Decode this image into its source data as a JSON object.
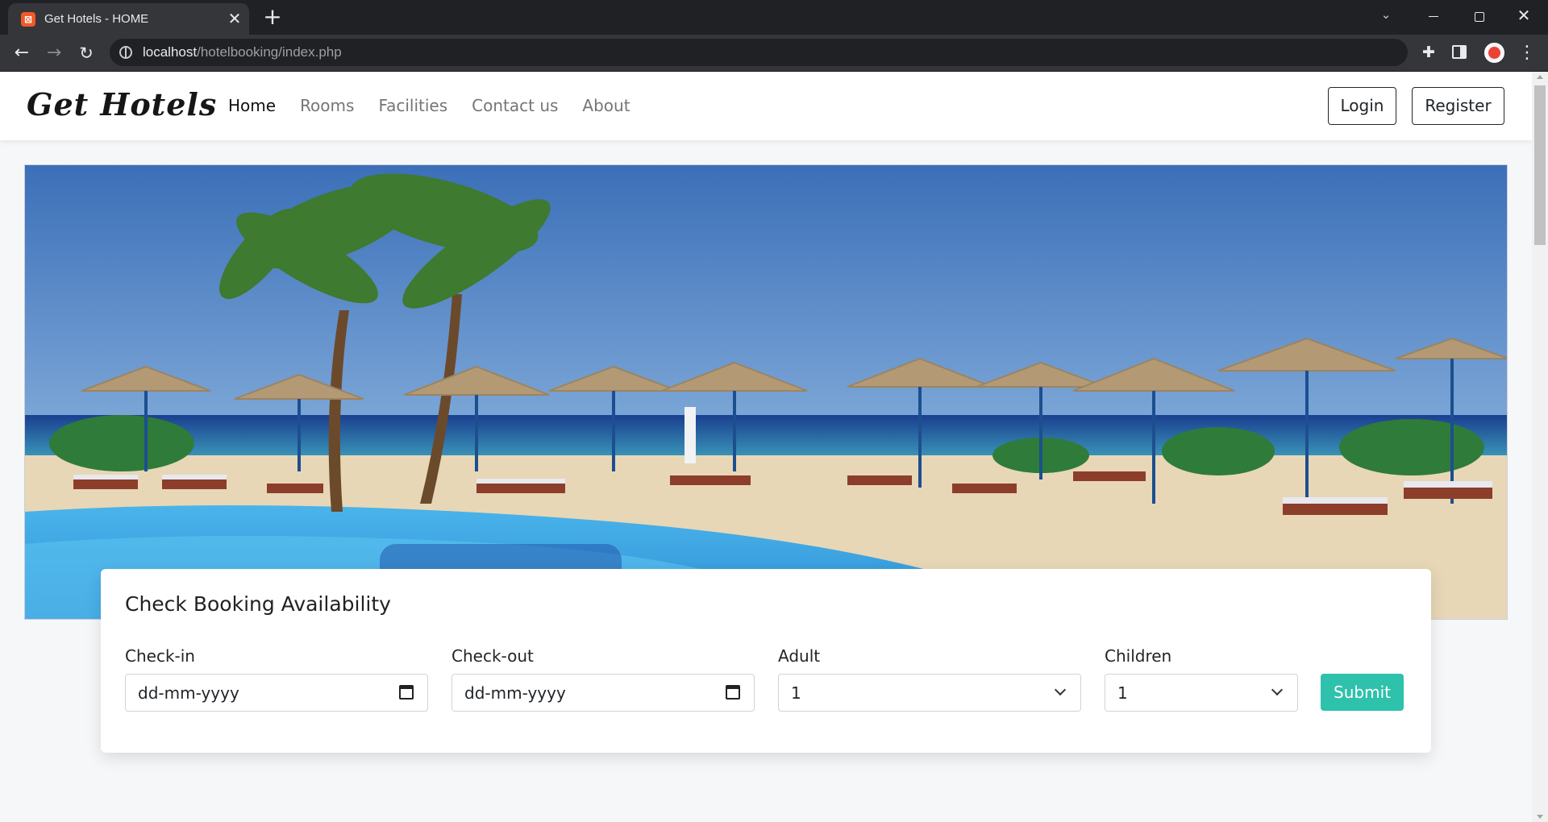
{
  "browser": {
    "tab_title": "Get Hotels - HOME",
    "tab_favicon": "xampp-icon",
    "new_tab_symbol": "+",
    "close_symbol": "✕",
    "url_host": "localhost",
    "url_path": "/hotelbooking/index.php",
    "window_close_symbol": "✕"
  },
  "navbar": {
    "brand": "Get Hotels",
    "links": [
      {
        "label": "Home",
        "active": true
      },
      {
        "label": "Rooms",
        "active": false
      },
      {
        "label": "Facilities",
        "active": false
      },
      {
        "label": "Contact us",
        "active": false
      },
      {
        "label": "About",
        "active": false
      }
    ],
    "login_label": "Login",
    "register_label": "Register"
  },
  "hero": {
    "image": "beach resort with pool, palm trees and straw umbrellas"
  },
  "booking": {
    "title": "Check Booking Availability",
    "checkin": {
      "label": "Check-in",
      "placeholder": "dd-mm-yyyy"
    },
    "checkout": {
      "label": "Check-out",
      "placeholder": "dd-mm-yyyy"
    },
    "adult": {
      "label": "Adult",
      "value": "1"
    },
    "children": {
      "label": "Children",
      "value": "1"
    },
    "submit_label": "Submit"
  },
  "colors": {
    "accent": "#2ec1ac",
    "chrome_dark": "#202124",
    "chrome_toolbar": "#35363a"
  }
}
